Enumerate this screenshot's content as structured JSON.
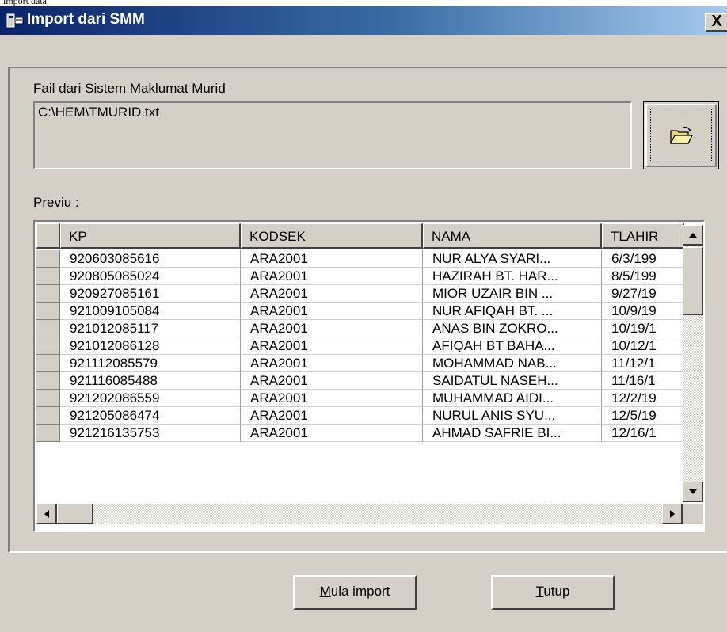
{
  "window": {
    "title": "Import dari SMM",
    "close_glyph": "X"
  },
  "file_section": {
    "label": "Fail dari Sistem Maklumat Murid",
    "path": "C:\\HEM\\TMURID.txt",
    "browse_icon": "open-folder-icon"
  },
  "preview": {
    "label": "Previu :",
    "columns": [
      "KP",
      "KODSEK",
      "NAMA",
      "TLAHIR"
    ],
    "rows": [
      [
        "920603085616",
        "ARA2001",
        "NUR ALYA SYARI...",
        "6/3/199"
      ],
      [
        "920805085024",
        "ARA2001",
        "HAZIRAH BT. HAR...",
        "8/5/199"
      ],
      [
        "920927085161",
        "ARA2001",
        "MIOR UZAIR BIN ...",
        "9/27/19"
      ],
      [
        "921009105084",
        "ARA2001",
        "NUR AFIQAH BT. ...",
        "10/9/19"
      ],
      [
        "921012085117",
        "ARA2001",
        "ANAS BIN ZOKRO...",
        "10/19/1"
      ],
      [
        "921012086128",
        "ARA2001",
        "AFIQAH BT BAHA...",
        "10/12/1"
      ],
      [
        "921112085579",
        "ARA2001",
        "MOHAMMAD NAB...",
        "11/12/1"
      ],
      [
        "921116085488",
        "ARA2001",
        "SAIDATUL NASEH...",
        "11/16/1"
      ],
      [
        "921202086559",
        "ARA2001",
        "MUHAMMAD AIDI...",
        "12/2/19"
      ],
      [
        "921205086474",
        "ARA2001",
        "NURUL ANIS SYU...",
        "12/5/19"
      ],
      [
        "921216135753",
        "ARA2001",
        "AHMAD SAFRIE BI...",
        "12/16/1"
      ]
    ]
  },
  "buttons": {
    "start_accel": "M",
    "start_rest": "ula import",
    "close_accel": "T",
    "close_rest": "utup"
  },
  "colors": {
    "face": "#d4d0c8",
    "title_start": "#0a246a",
    "title_end": "#a6caf0"
  }
}
